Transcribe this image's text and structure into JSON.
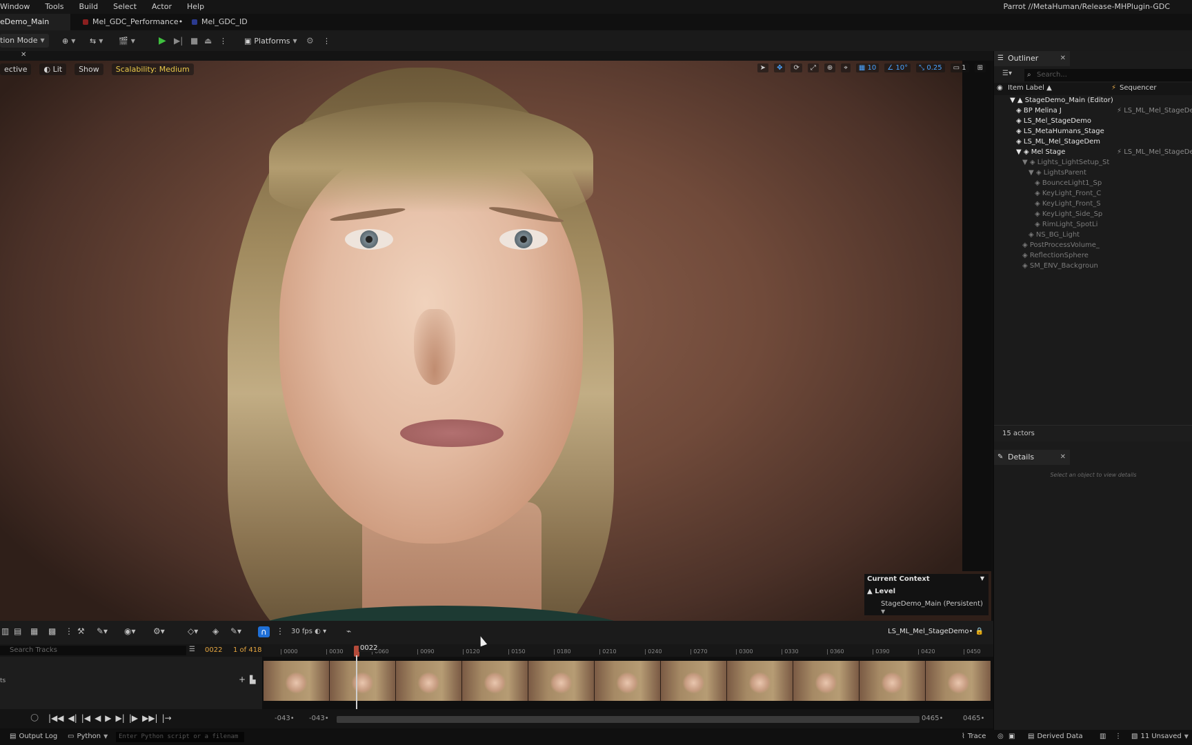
{
  "menubar": {
    "items": [
      "Window",
      "Tools",
      "Build",
      "Select",
      "Actor",
      "Help"
    ],
    "source_path": "Parrot //MetaHuman/Release-MHPlugin-GDC"
  },
  "tabs": [
    {
      "label": "eDemo_Main",
      "active": true,
      "color": "#1f1f1f"
    },
    {
      "label": "Mel_GDC_Performance•",
      "active": false,
      "color": "#8b1f1f"
    },
    {
      "label": "Mel_GDC_ID",
      "active": false,
      "color": "#2b3a8f"
    }
  ],
  "toolbar": {
    "mode_label": "tion Mode",
    "platforms_label": "Platforms"
  },
  "viewport": {
    "perspective_label": "ective",
    "lit_label": "Lit",
    "show_label": "Show",
    "scalability_label": "Scalability: Medium",
    "grid_value": "10",
    "angle_value": "10°",
    "scale_value": "0.25",
    "camera_value": "1"
  },
  "current_context": {
    "title": "Current Context",
    "level_label": "Level",
    "level_value": "StageDemo_Main (Persistent)"
  },
  "sequencer": {
    "fps_label": "30 fps",
    "sequence_name": "LS_ML_Mel_StageDemo•",
    "search_placeholder": "Search Tracks",
    "current_frame": "0022",
    "frame_count": "1 of 418",
    "playhead_label": "0022",
    "ticks": [
      "0000",
      "0030",
      "0060",
      "0090",
      "0120",
      "0150",
      "0180",
      "0210",
      "0240",
      "0270",
      "0300",
      "0330",
      "0360",
      "0390",
      "0420",
      "0450"
    ],
    "track_label": "ts",
    "range_start_a": "-043•",
    "range_start_b": "-043•",
    "range_end_a": "0465•",
    "range_end_b": "0465•",
    "thumbnail_count": 11
  },
  "statusbar": {
    "output_log": "Output Log",
    "python_label": "Python",
    "console_placeholder": "Enter Python script or a filenam",
    "trace_label": "Trace",
    "derived_data_label": "Derived Data",
    "unsaved_label": "11 Unsaved"
  },
  "outliner": {
    "tab_label": "Outliner",
    "search_placeholder": "Search...",
    "col_item_label": "Item Label ▲",
    "col_sequencer": "Sequencer",
    "rows": [
      {
        "label": "StageDemo_Main (Editor)",
        "indent": 1,
        "dim": false,
        "seq": ""
      },
      {
        "label": "BP Melina J",
        "indent": 2,
        "dim": false,
        "seq": "LS_ML_Mel_StageDemo"
      },
      {
        "label": "LS_Mel_StageDemo",
        "indent": 2,
        "dim": false,
        "seq": ""
      },
      {
        "label": "LS_MetaHumans_Stage",
        "indent": 2,
        "dim": false,
        "seq": ""
      },
      {
        "label": "LS_ML_Mel_StageDem",
        "indent": 2,
        "dim": false,
        "seq": ""
      },
      {
        "label": "Mel Stage",
        "indent": 2,
        "dim": false,
        "seq": "LS_ML_Mel_StageDemo"
      },
      {
        "label": "Lights_LightSetup_St",
        "indent": 3,
        "dim": true,
        "seq": ""
      },
      {
        "label": "LightsParent",
        "indent": 4,
        "dim": true,
        "seq": ""
      },
      {
        "label": "BounceLight1_Sp",
        "indent": 5,
        "dim": true,
        "seq": ""
      },
      {
        "label": "KeyLight_Front_C",
        "indent": 5,
        "dim": true,
        "seq": ""
      },
      {
        "label": "KeyLight_Front_S",
        "indent": 5,
        "dim": true,
        "seq": ""
      },
      {
        "label": "KeyLight_Side_Sp",
        "indent": 5,
        "dim": true,
        "seq": ""
      },
      {
        "label": "RimLight_SpotLi",
        "indent": 5,
        "dim": true,
        "seq": ""
      },
      {
        "label": "NS_BG_Light",
        "indent": 4,
        "dim": true,
        "seq": ""
      },
      {
        "label": "PostProcessVolume_",
        "indent": 3,
        "dim": true,
        "seq": ""
      },
      {
        "label": "ReflectionSphere",
        "indent": 3,
        "dim": true,
        "seq": ""
      },
      {
        "label": "SM_ENV_Backgroun",
        "indent": 3,
        "dim": true,
        "seq": ""
      }
    ],
    "actors_count": "15 actors"
  },
  "details": {
    "tab_label": "Details",
    "empty_text": "Select an object to view details"
  }
}
